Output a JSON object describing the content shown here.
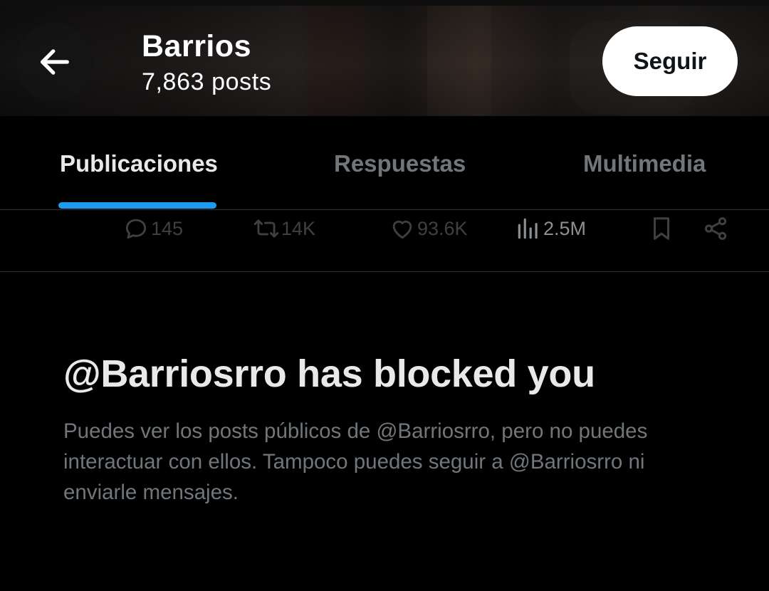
{
  "header": {
    "back_icon": "arrow-left-icon",
    "name": "Barrios",
    "post_count": "7,863 posts",
    "follow_label": "Seguir"
  },
  "tabs": [
    {
      "label": "Publicaciones",
      "active": true
    },
    {
      "label": "Respuestas",
      "active": false
    },
    {
      "label": "Multimedia",
      "active": false
    }
  ],
  "actions": {
    "replies": "145",
    "reposts": "14K",
    "likes": "93.6K",
    "views": "2.5M",
    "icons": [
      "reply-icon",
      "repost-icon",
      "like-icon",
      "views-icon",
      "bookmark-icon",
      "share-icon"
    ]
  },
  "blocked": {
    "title": "@Barriosrro has blocked you",
    "description": "Puedes ver los posts públicos de @Barriosrro, pero no puedes interactuar con ellos. Tampoco puedes seguir a @Barriosrro ni enviarle mensajes."
  },
  "colors": {
    "accent": "#1d9bf0",
    "background": "#000000",
    "text_primary": "#e7e9ea",
    "text_secondary": "#71767b",
    "divider": "#2f3336"
  }
}
